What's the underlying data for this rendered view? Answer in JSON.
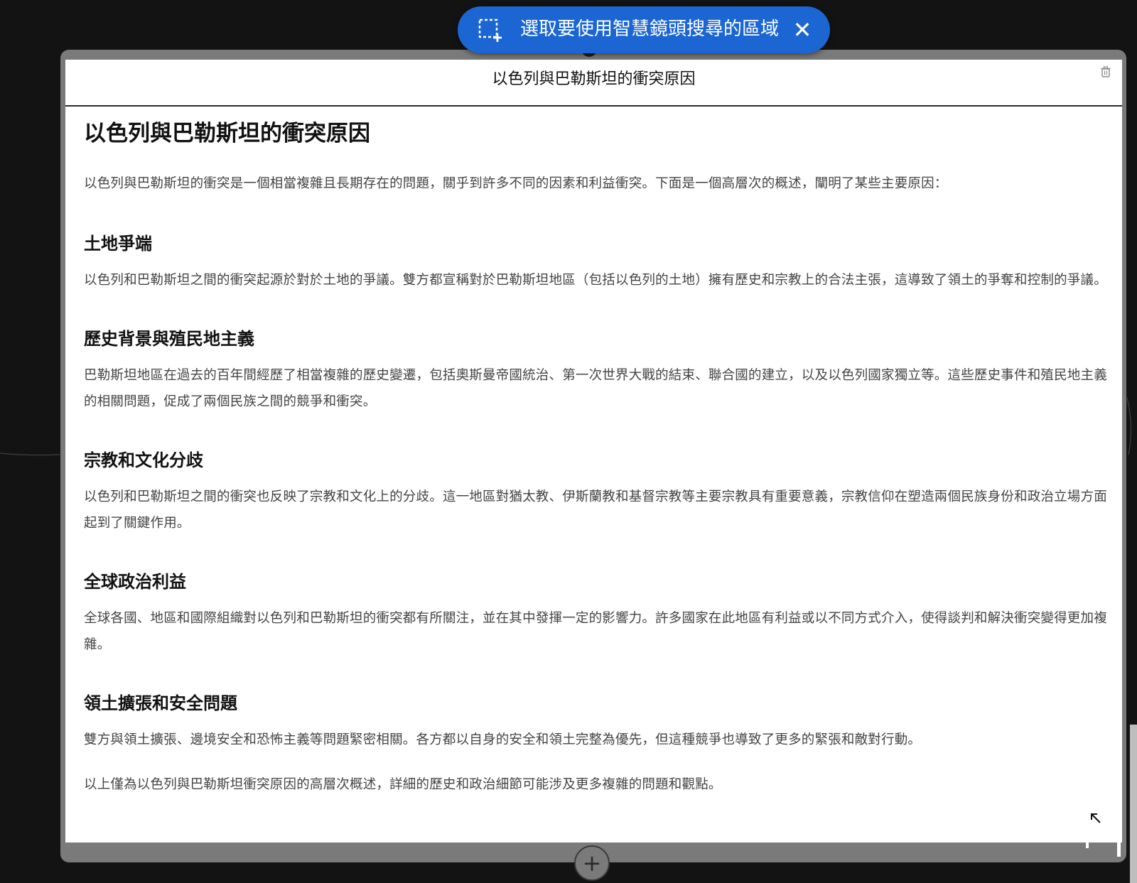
{
  "lens_banner": {
    "text": "選取要使用智慧鏡頭搜尋的區域",
    "close_symbol": "✕",
    "icon": "select-region-icon"
  },
  "card": {
    "header_title": "以色列與巴勒斯坦的衝突原因",
    "delete_icon": "trash-icon"
  },
  "document": {
    "title": "以色列與巴勒斯坦的衝突原因",
    "intro": "以色列與巴勒斯坦的衝突是一個相當複雜且長期存在的問題，關乎到許多不同的因素和利益衝突。下面是一個高層次的概述，闡明了某些主要原因：",
    "sections": [
      {
        "heading": "土地爭端",
        "body": "以色列和巴勒斯坦之間的衝突起源於對於土地的爭議。雙方都宣稱對於巴勒斯坦地區（包括以色列的土地）擁有歷史和宗教上的合法主張，這導致了領土的爭奪和控制的爭議。"
      },
      {
        "heading": "歷史背景與殖民地主義",
        "body": "巴勒斯坦地區在過去的百年間經歷了相當複雜的歷史變遷，包括奧斯曼帝國統治、第一次世界大戰的結束、聯合國的建立，以及以色列國家獨立等。這些歷史事件和殖民地主義的相關問題，促成了兩個民族之間的競爭和衝突。"
      },
      {
        "heading": "宗教和文化分歧",
        "body": "以色列和巴勒斯坦之間的衝突也反映了宗教和文化上的分歧。這一地區對猶太教、伊斯蘭教和基督宗教等主要宗教具有重要意義，宗教信仰在塑造兩個民族身份和政治立場方面起到了關鍵作用。"
      },
      {
        "heading": "全球政治利益",
        "body": "全球各國、地區和國際組織對以色列和巴勒斯坦的衝突都有所關注，並在其中發揮一定的影響力。許多國家在此地區有利益或以不同方式介入，使得談判和解決衝突變得更加複雜。"
      },
      {
        "heading": "領土擴張和安全問題",
        "body": "雙方與領土擴張、邊境安全和恐怖主義等問題緊密相關。各方都以自身的安全和領土完整為優先，但這種競爭也導致了更多的緊張和敵對行動。"
      }
    ],
    "closing": "以上僅為以色列與巴勒斯坦衝突原因的高層次概述，詳細的歷史和政治細節可能涉及更多複雜的問題和觀點。"
  },
  "canvas": {
    "add_symbol": "+",
    "add_icon": "plus-icon",
    "resize_icon": "resize-handle-icon"
  },
  "colors": {
    "banner_blue": "#1b66d2",
    "background": "#131313",
    "card_border": "#7a7a7a"
  }
}
